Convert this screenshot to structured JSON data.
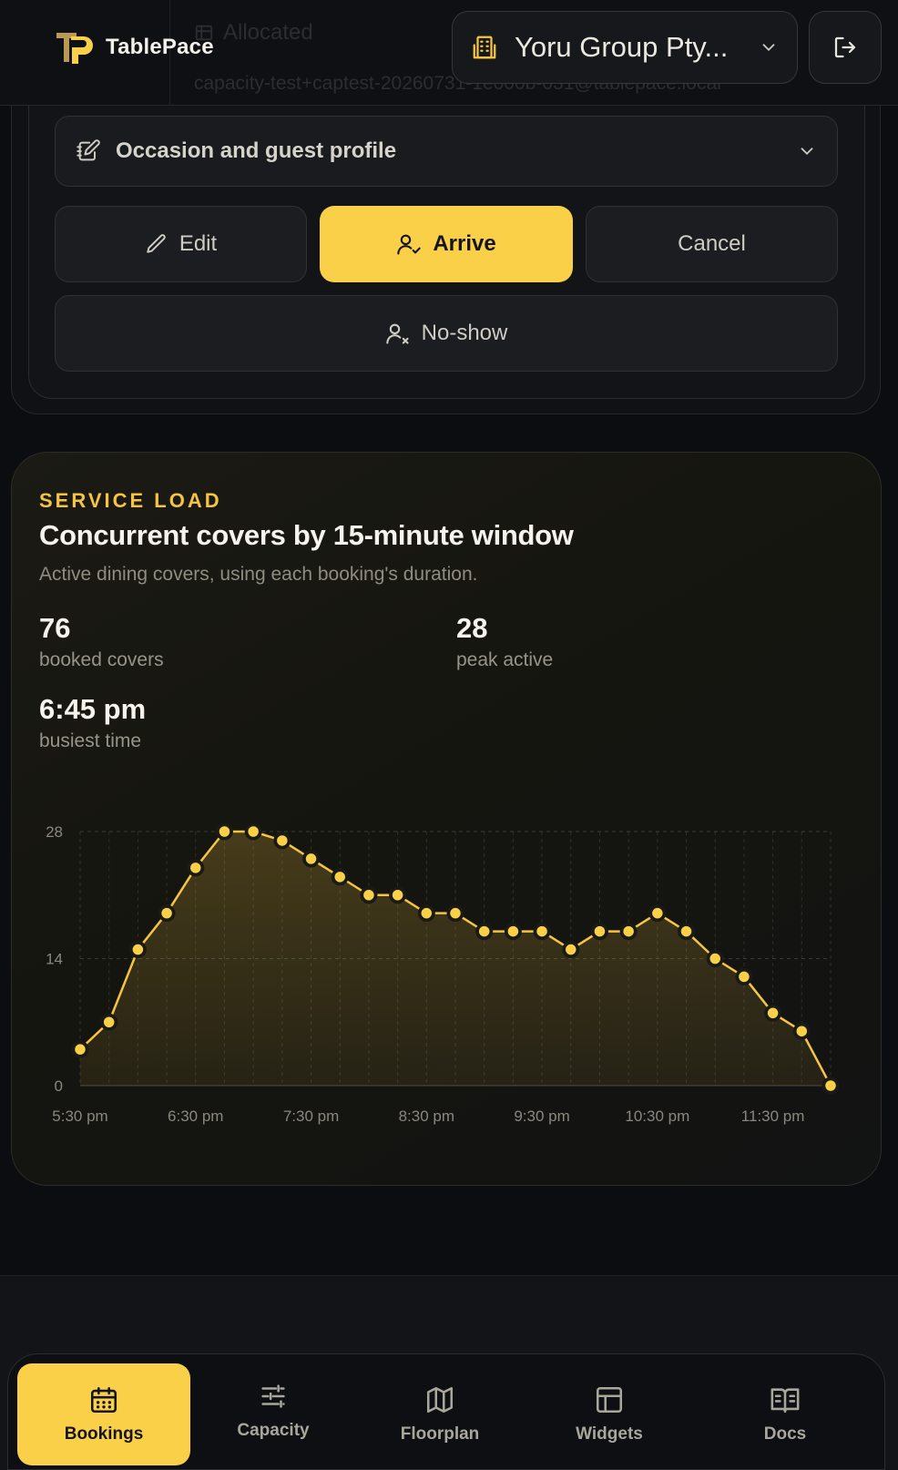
{
  "header": {
    "logo_text": "TablePace",
    "org_name": "Yoru Group Pty...",
    "ghost_status": "Allocated",
    "ghost_email": "capacity-test+captest-20260731-1e000b-031@tablepace.local",
    "logout_label": "Sign out"
  },
  "booking_actions": {
    "accordion_label": "Occasion and guest profile",
    "edit_label": "Edit",
    "arrive_label": "Arrive",
    "cancel_label": "Cancel",
    "noshow_label": "No-show"
  },
  "service_load": {
    "eyebrow": "SERVICE LOAD",
    "title": "Concurrent covers by 15-minute window",
    "subtitle": "Active dining covers, using each booking's duration.",
    "stats": [
      {
        "value": "76",
        "label": "booked covers"
      },
      {
        "value": "28",
        "label": "peak active"
      },
      {
        "value": "6:45 pm",
        "label": "busiest time"
      }
    ]
  },
  "chart_data": {
    "type": "area",
    "title": "",
    "xlabel": "",
    "ylabel": "",
    "ylim": [
      0,
      28
    ],
    "yticks": [
      0,
      14,
      28
    ],
    "x": [
      "5:30 pm",
      "5:45 pm",
      "6:00 pm",
      "6:15 pm",
      "6:30 pm",
      "6:45 pm",
      "7:00 pm",
      "7:15 pm",
      "7:30 pm",
      "7:45 pm",
      "8:00 pm",
      "8:15 pm",
      "8:30 pm",
      "8:45 pm",
      "9:00 pm",
      "9:15 pm",
      "9:30 pm",
      "9:45 pm",
      "10:00 pm",
      "10:15 pm",
      "10:30 pm",
      "10:45 pm",
      "11:00 pm",
      "11:15 pm",
      "11:30 pm",
      "11:45 pm",
      "12:00 am"
    ],
    "xtick_labels": [
      "5:30 pm",
      "6:30 pm",
      "7:30 pm",
      "8:30 pm",
      "9:30 pm",
      "10:30 pm",
      "11:30 pm"
    ],
    "series": [
      {
        "values": [
          4,
          7,
          15,
          19,
          24,
          28,
          28,
          27,
          25,
          23,
          21,
          21,
          19,
          19,
          17,
          17,
          17,
          15,
          17,
          17,
          19,
          17,
          14,
          12,
          8,
          6,
          0
        ]
      }
    ],
    "grid": true,
    "line_color": "#f5c542",
    "point_fill": "#fbd049"
  },
  "nav": {
    "items": [
      {
        "label": "Bookings",
        "icon": "calendar-icon",
        "active": true
      },
      {
        "label": "Capacity",
        "icon": "sliders-icon",
        "active": false
      },
      {
        "label": "Floorplan",
        "icon": "map-icon",
        "active": false
      },
      {
        "label": "Widgets",
        "icon": "layout-icon",
        "active": false
      },
      {
        "label": "Docs",
        "icon": "book-icon",
        "active": false
      }
    ]
  },
  "colors": {
    "accent": "#fbd049",
    "eyebrow": "#f5c542",
    "background": "#0b0d11"
  }
}
